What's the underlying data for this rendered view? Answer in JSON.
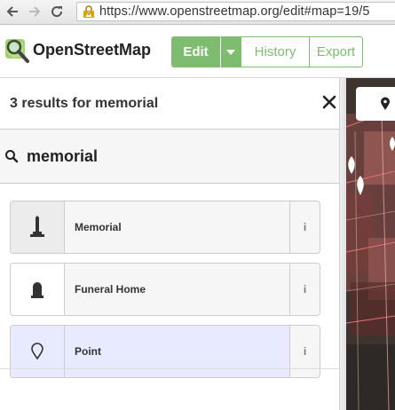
{
  "browser": {
    "url": "https://www.openstreetmap.org/edit#map=19/5"
  },
  "header": {
    "brand": "OpenStreetMap",
    "edit_label": "Edit",
    "history_label": "History",
    "export_label": "Export"
  },
  "search": {
    "results_title": "3 results for memorial",
    "query": "memorial"
  },
  "presets": [
    {
      "label": "Memorial",
      "icon": "memorial-icon"
    },
    {
      "label": "Funeral Home",
      "icon": "funeral-home-icon"
    },
    {
      "label": "Point",
      "icon": "point-icon"
    }
  ],
  "colors": {
    "accent_green": "#7ebc6f",
    "selected_bg": "#e8ebff"
  }
}
